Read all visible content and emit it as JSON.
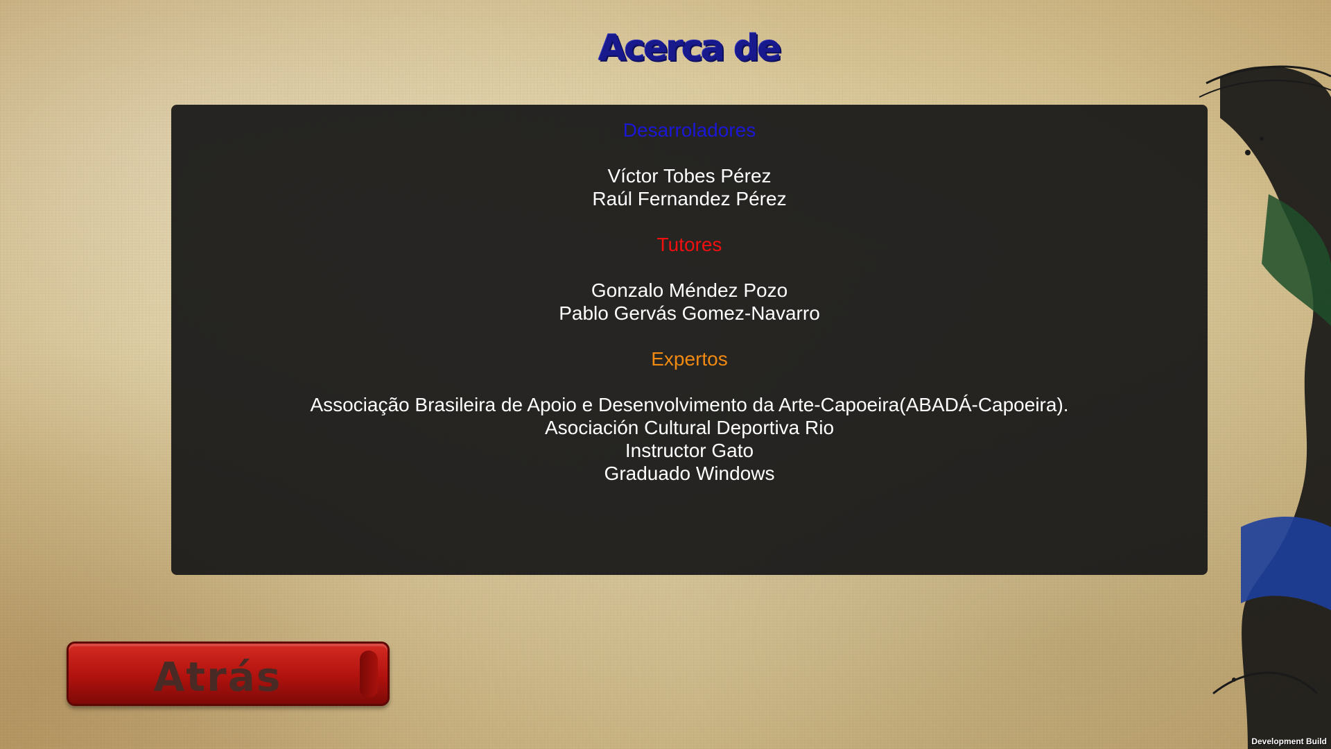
{
  "screen": {
    "title": "Acerca de",
    "dev_build_label": "Development Build"
  },
  "sections": {
    "developers": {
      "heading": "Desarroladores",
      "names": [
        "Víctor Tobes Pérez",
        "Raúl Fernandez Pérez"
      ]
    },
    "tutors": {
      "heading": "Tutores",
      "names": [
        "Gonzalo Méndez Pozo",
        "Pablo Gervás Gomez-Navarro"
      ]
    },
    "experts": {
      "heading": "Expertos",
      "names": [
        "Associação Brasileira de Apoio e Desenvolvimento da Arte-Capoeira(ABADÁ-Capoeira).",
        "Asociación Cultural Deportiva Rio",
        "Instructor Gato",
        "Graduado Windows"
      ]
    }
  },
  "buttons": {
    "back_label": "Atrás"
  },
  "colors": {
    "title": "#17198c",
    "developers_heading": "#1c17d6",
    "tutors_heading": "#f01010",
    "experts_heading": "#f28a12",
    "panel_background": "#191919",
    "back_button": "#b0120e"
  },
  "icons": {
    "background_decor": "capoeira-silhouette-icon"
  }
}
